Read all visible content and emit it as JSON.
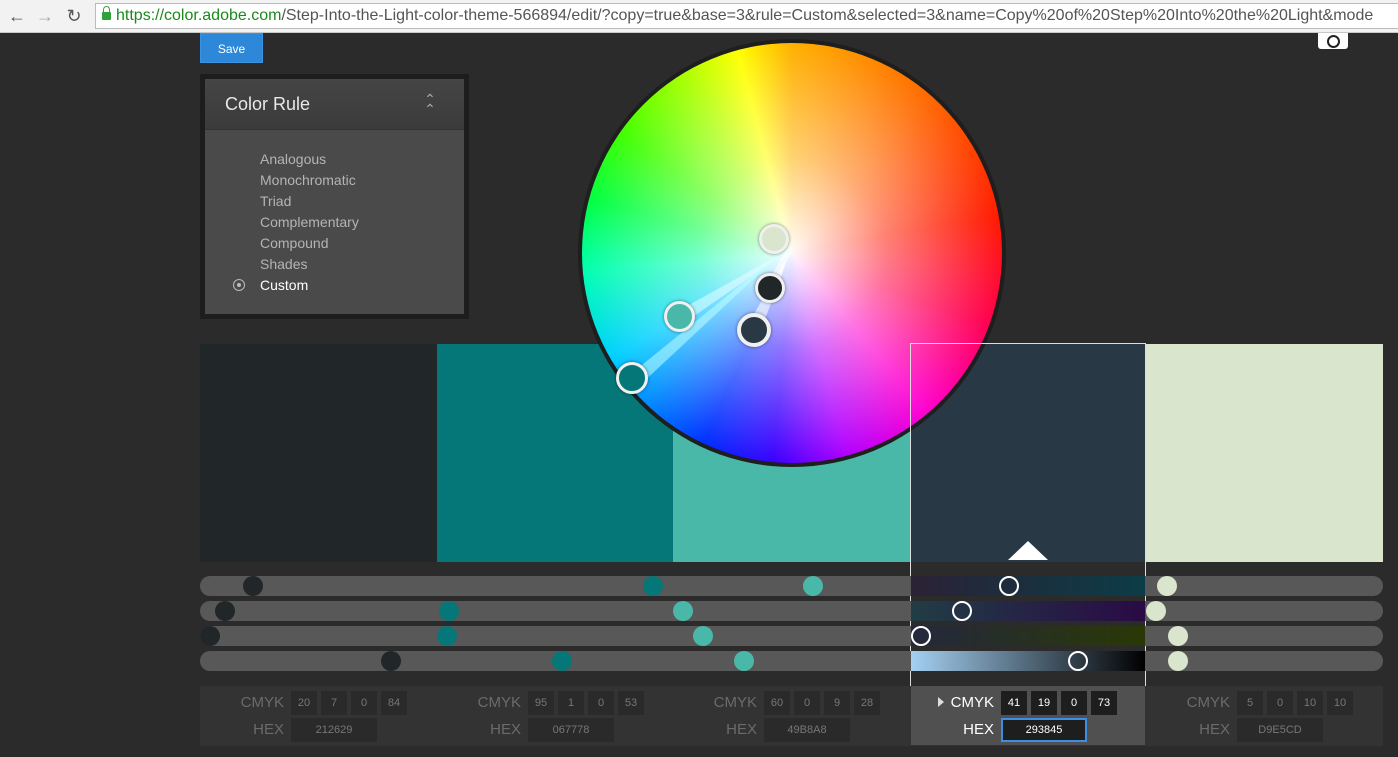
{
  "browser": {
    "url_host": "https://color.adobe.com",
    "url_path": "/Step-Into-the-Light-color-theme-566894/edit/?copy=true&base=3&rule=Custom&selected=3&name=Copy%20of%20Step%20Into%20the%20Light&mode",
    "back_icon": "arrow-left",
    "forward_icon": "arrow-right",
    "reload_icon": "reload"
  },
  "toolbar": {
    "save_label": "Save",
    "camera_icon": "camera"
  },
  "color_rule": {
    "title": "Color Rule",
    "collapse_icon": "double-chevron-up",
    "options": [
      "Analogous",
      "Monochromatic",
      "Triad",
      "Complementary",
      "Compound",
      "Shades",
      "Custom"
    ],
    "selected": "Custom"
  },
  "swatches": [
    {
      "hex_color": "#212629",
      "cmyk_label": "CMYK",
      "cmyk": [
        "20",
        "7",
        "0",
        "84"
      ],
      "hex_label": "HEX",
      "hex": "212629"
    },
    {
      "hex_color": "#067778",
      "cmyk_label": "CMYK",
      "cmyk": [
        "95",
        "1",
        "0",
        "53"
      ],
      "hex_label": "HEX",
      "hex": "067778"
    },
    {
      "hex_color": "#49B8A8",
      "cmyk_label": "CMYK",
      "cmyk": [
        "60",
        "0",
        "9",
        "28"
      ],
      "hex_label": "HEX",
      "hex": "49B8A8"
    },
    {
      "hex_color": "#293845",
      "cmyk_label": "CMYK",
      "cmyk": [
        "41",
        "19",
        "0",
        "73"
      ],
      "hex_label": "HEX",
      "hex": "293845",
      "active": true
    },
    {
      "hex_color": "#D9E5CD",
      "cmyk_label": "CMYK",
      "cmyk": [
        "5",
        "0",
        "10",
        "10"
      ],
      "hex_label": "HEX",
      "hex": "D9E5CD"
    }
  ],
  "colors": {
    "accent": "#2d88d9",
    "background": "#2b2b2b",
    "track": "#585858"
  }
}
